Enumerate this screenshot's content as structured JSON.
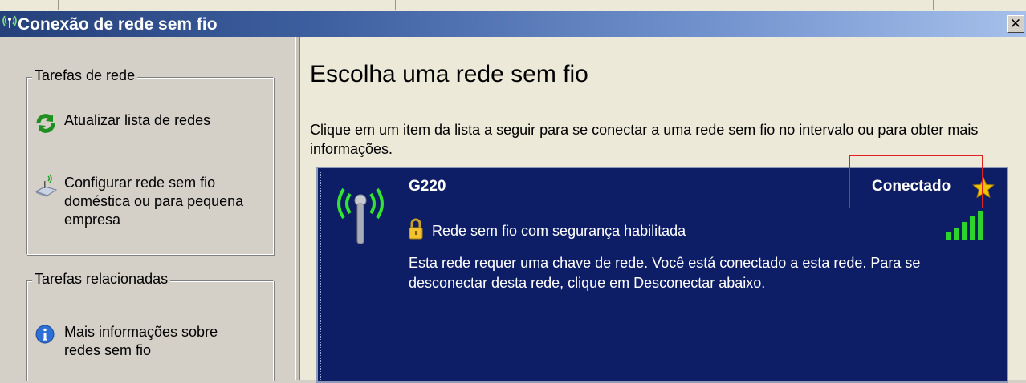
{
  "window": {
    "title": "Conexão de rede sem fio",
    "close_glyph": "✕",
    "title_icon": "wireless-network-icon"
  },
  "left_pane": {
    "network_tasks": {
      "title": "Tarefas de rede",
      "items": [
        {
          "label": "Atualizar lista de redes",
          "icon": "refresh-icon"
        },
        {
          "label": "Configurar rede sem fio doméstica ou para pequena empresa",
          "icon": "wireless-setup-icon"
        }
      ]
    },
    "related_tasks": {
      "title": "Tarefas relacionadas",
      "items": [
        {
          "label": "Mais informações sobre redes sem fio",
          "icon": "info-icon"
        }
      ]
    }
  },
  "main": {
    "heading": "Escolha uma rede sem fio",
    "intro": "Clique em um item da lista a seguir para se conectar a uma rede sem fio no intervalo ou para obter mais informações.",
    "network": {
      "ssid": "G220",
      "status": "Conectado",
      "security": "Rede sem fio com segurança habilitada",
      "description": "Esta rede requer uma chave de rede. Você está conectado a esta rede. Para se desconectar desta rede, clique em Desconectar abaixo.",
      "signal_bars": 5,
      "colors": {
        "card_bg": "#0d1e66",
        "signal": "#2fd32f",
        "star": "#f5c400"
      }
    }
  }
}
